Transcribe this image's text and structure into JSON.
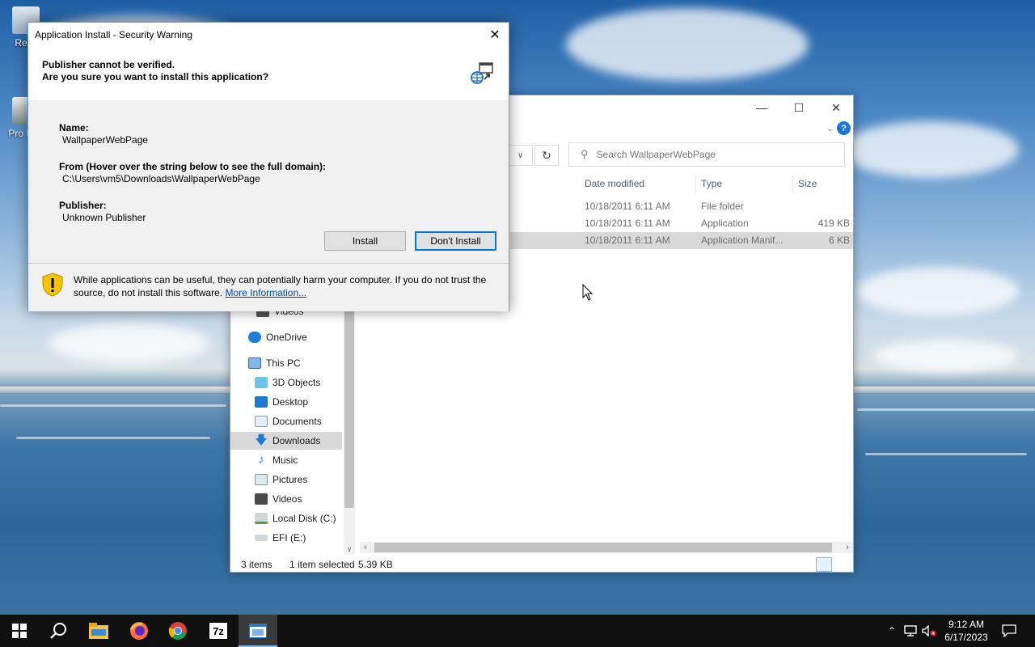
{
  "desktop": {
    "icons": [
      {
        "label": "Recy"
      },
      {
        "label": "Pro Hac"
      }
    ]
  },
  "explorer": {
    "search": {
      "placeholder": "Search WallpaperWebPage"
    },
    "columns": [
      "Date modified",
      "Type",
      "Size"
    ],
    "files": [
      {
        "date": "10/18/2011 6:11 AM",
        "type": "File folder",
        "size": ""
      },
      {
        "date": "10/18/2011 6:11 AM",
        "type": "Application",
        "size": "419 KB"
      },
      {
        "date": "10/18/2011 6:11 AM",
        "type": "Application Manif...",
        "size": "6 KB"
      }
    ],
    "nav": [
      {
        "label": "Videos"
      },
      {
        "label": "OneDrive"
      },
      {
        "label": "This PC"
      },
      {
        "label": "3D Objects"
      },
      {
        "label": "Desktop"
      },
      {
        "label": "Documents"
      },
      {
        "label": "Downloads"
      },
      {
        "label": "Music"
      },
      {
        "label": "Pictures"
      },
      {
        "label": "Videos"
      },
      {
        "label": "Local Disk (C:)"
      },
      {
        "label": "EFI (E:)"
      }
    ],
    "status": {
      "items": "3 items",
      "selected": "1 item selected",
      "size": "5.39 KB"
    }
  },
  "dialog": {
    "title": "Application Install - Security Warning",
    "header_line1": "Publisher cannot be verified.",
    "header_line2": "Are you sure you want to install this application?",
    "name_label": "Name:",
    "name_value": "WallpaperWebPage",
    "from_label": "From (Hover over the string below to see the full domain):",
    "from_value": "C:\\Users\\vm5\\Downloads\\WallpaperWebPage",
    "publisher_label": "Publisher:",
    "publisher_value": "Unknown Publisher",
    "install_button": "Install",
    "dont_install_button": "Don't Install",
    "warning_text": "While applications can be useful, they can potentially harm your computer. If you do not trust the source, do not install this software.",
    "more_info_link": "More Information..."
  },
  "taskbar": {
    "apps": [
      "start-icon",
      "search-icon",
      "file-explorer-icon",
      "firefox-icon",
      "chrome-icon",
      "7zip-icon",
      "installer-icon"
    ],
    "sevenzip_label": "7z",
    "clock_time": "9:12 AM",
    "clock_date": "6/17/2023"
  },
  "colors": {
    "accent": "#0078d7",
    "selection": "#d9d9d9",
    "link": "#0645ad",
    "taskbar": "#101010"
  }
}
